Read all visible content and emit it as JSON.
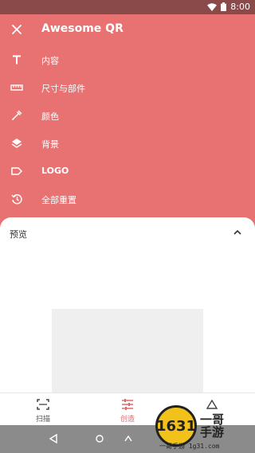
{
  "status_bar": {
    "time": "8:00"
  },
  "app_bar": {
    "title": "Awesome QR"
  },
  "menu": {
    "items": [
      {
        "label": "内容",
        "icon": "text-t-icon"
      },
      {
        "label": "尺寸与部件",
        "icon": "ruler-icon"
      },
      {
        "label": "颜色",
        "icon": "eyedropper-icon"
      },
      {
        "label": "背景",
        "icon": "layers-icon"
      },
      {
        "label": "LOGO",
        "icon": "label-tag-icon"
      },
      {
        "label": "全部重置",
        "icon": "history-icon"
      }
    ]
  },
  "sheet": {
    "title": "预览"
  },
  "bottom_nav": {
    "items": [
      {
        "label": "扫描",
        "icon": "scan-frame-icon",
        "active": false
      },
      {
        "label": "创造",
        "icon": "tune-sliders-icon",
        "active": true
      },
      {
        "label": "",
        "icon": "triangle-icon",
        "active": false
      }
    ]
  },
  "watermark": {
    "badge": "1631",
    "line1": "一哥",
    "line2": "手游",
    "url": "一哥手游 1g31.com"
  },
  "colors": {
    "primary": "#e87171",
    "status_bar": "#8a4a4a",
    "active_nav": "#e06a6a"
  }
}
